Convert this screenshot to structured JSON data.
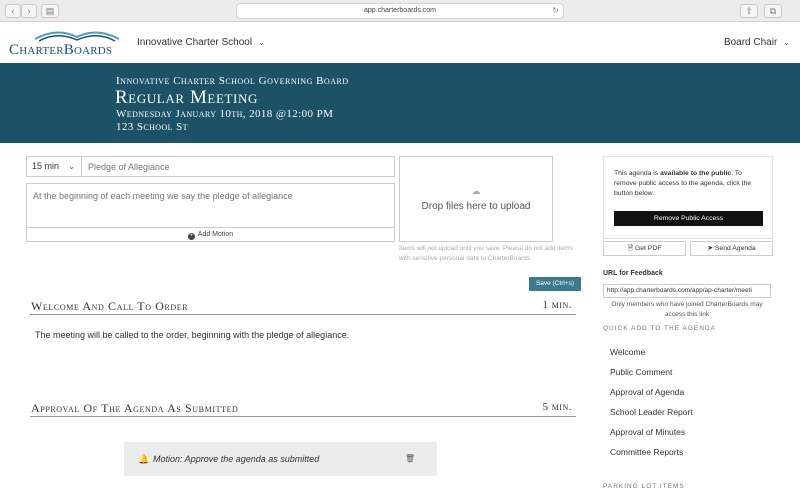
{
  "browser": {
    "url": "app.charterboards.com"
  },
  "header": {
    "logo_text": "CharterBoards",
    "school": "Innovative Charter School",
    "role": "Board Chair"
  },
  "banner": {
    "org": "Innovative Charter School Governing Board",
    "meeting": "Regular Meeting",
    "datetime": "Wednesday January 10th, 2018 @12:00 PM",
    "location": "123 School St"
  },
  "editor": {
    "duration": "15 min",
    "title_placeholder": "Pledge of Allegiance",
    "desc_placeholder": "At the beginning of each meeting we say the pledge of allegiance",
    "add_motion": "Add Motion",
    "dropzone": "Drop files here to upload",
    "upload_note": "Items will not upload until you save. Please do not add items with sensitive personal data to CharterBoards.",
    "save": "Save (Ctrl+s)"
  },
  "agenda": [
    {
      "name": "Welcome And Call To Order",
      "time": "1 min.",
      "body": "The meeting will be called to the order, beginning with the pledge of allegiance."
    },
    {
      "name": "Approval Of The Agenda As Submitted",
      "time": "5 min.",
      "motion": "Motion: Approve the agenda as submitted"
    }
  ],
  "sidebar": {
    "public_msg_pre": "This agenda is ",
    "public_msg_bold": "available to the public",
    "public_msg_post": ". To remove public access to the agenda, click the button below.",
    "remove_public": "Remove Public Access",
    "get_pdf": "Get PDF",
    "send_agenda": "Send Agenda",
    "feedback_label": "URL for Feedback",
    "feedback_url": "http://app.charterboards.com/app/ap-charter/meeti",
    "feedback_note": "Only members who have joined CharterBoards may access this link",
    "quick_add_label": "QUICK ADD TO THE AGENDA",
    "quick_add": [
      "Welcome",
      "Public Comment",
      "Approval of Agenda",
      "School Leader Report",
      "Approval of Minutes",
      "Committee Reports"
    ],
    "parking_label": "PARKING LOT ITEMS"
  }
}
